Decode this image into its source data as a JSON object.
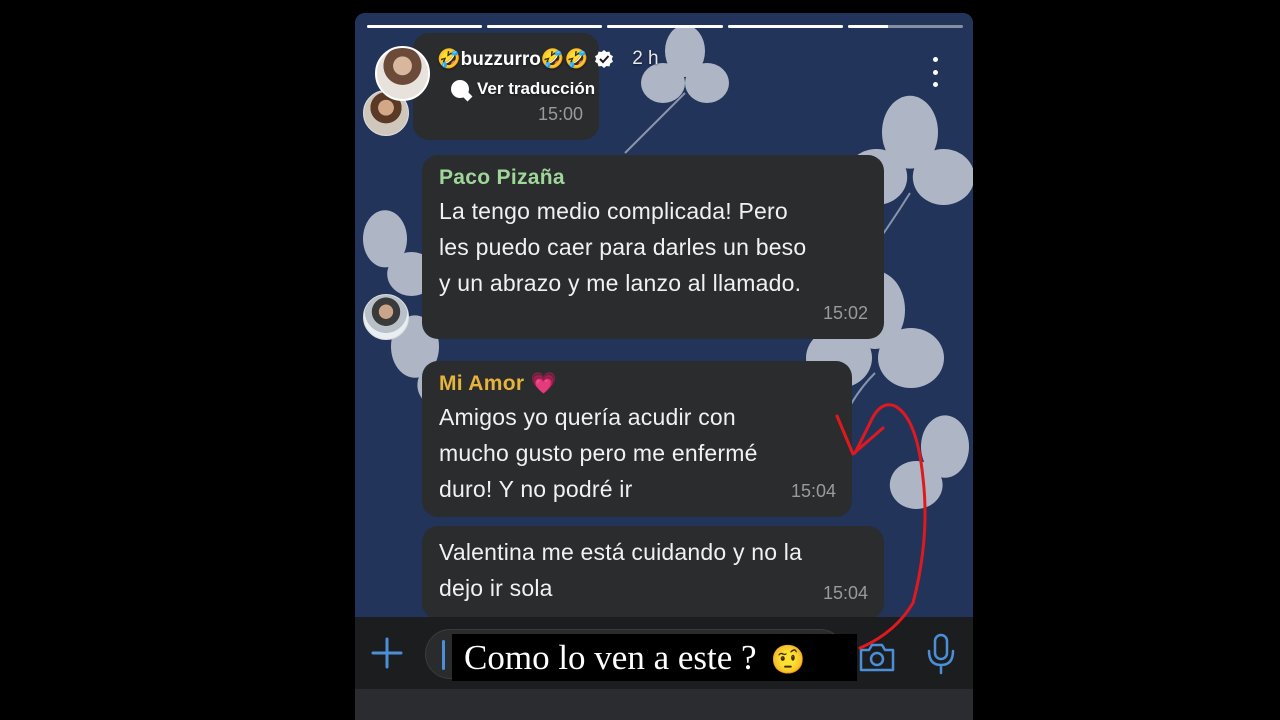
{
  "story": {
    "progress_segments": [
      1,
      1,
      1,
      1,
      0.35
    ],
    "username": "🤣buzzurro🤣🤣",
    "verified_icon": "verified-badge-icon",
    "time_ago": "2 h",
    "translate_label": "Ver traducción",
    "menu_icon": "more-vertical-icon"
  },
  "chat": {
    "messages": [
      {
        "sender": "",
        "sender_color": "",
        "text": "",
        "time": "15:00"
      },
      {
        "sender": "Paco  Pizaña",
        "sender_color": "#9fd69a",
        "text": "La tengo medio complicada! Pero\nles puedo caer para darles un beso\ny un abrazo y me lanzo al llamado.",
        "time": "15:02"
      },
      {
        "sender": "Mi Amor 💗",
        "sender_color": "#e6b43c",
        "text": "Amigos yo quería acudir con\nmucho gusto pero me enfermé\nduro! Y no podré ir",
        "time": "15:04"
      },
      {
        "sender": "",
        "sender_color": "",
        "text": "Valentina me está cuidando y no la\ndejo ir sola",
        "time": "15:04"
      }
    ]
  },
  "input_bar": {
    "plus_icon": "plus-icon",
    "camera_icon": "camera-icon",
    "mic_icon": "microphone-icon",
    "accent_color": "#4a8fd8"
  },
  "caption": {
    "text": "Como lo ven a este ?",
    "emoji": "🤨"
  },
  "annotation": {
    "color": "#e0191f"
  }
}
